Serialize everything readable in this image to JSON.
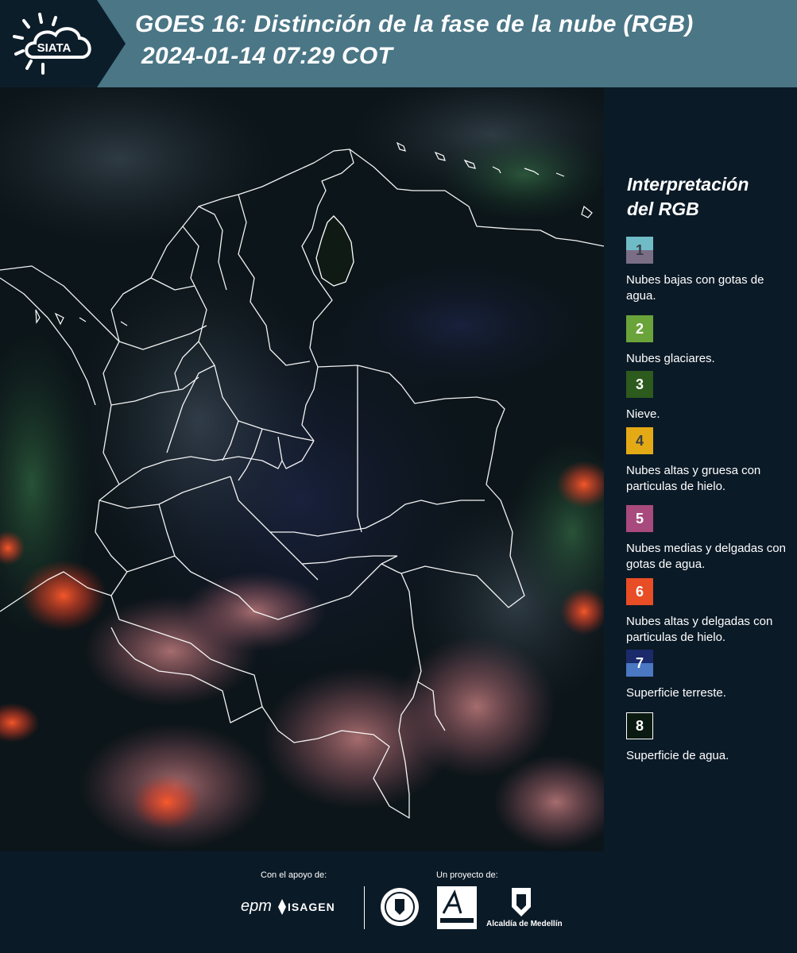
{
  "header": {
    "brand": "SIATA",
    "title_line1": "GOES 16: Distinción de la fase de la nube (RGB)",
    "title_line2": "2024-01-14 07:29 COT"
  },
  "colors": {
    "header_bg": "#4a7686",
    "header_dark": "#0c1d2a",
    "panel_bg": "#0b1a27",
    "border_line": "#ffffff"
  },
  "legend": {
    "title_line1": "Interpretación",
    "title_line2": "del RGB",
    "items": [
      {
        "num": "1",
        "color_top": "#6fbcc7",
        "color_bottom": "#7a6e86",
        "text": "Nubes bajas con gotas de agua."
      },
      {
        "num": "2",
        "color": "#6aa33a",
        "text": "Nubes glaciares."
      },
      {
        "num": "3",
        "color": "#2d5a1d",
        "text": "Nieve."
      },
      {
        "num": "4",
        "color": "#e4aa16",
        "text": "Nubes altas y gruesa con particulas de hielo."
      },
      {
        "num": "5",
        "color": "#a84a7d",
        "text": "Nubes medias y delgadas con gotas de agua."
      },
      {
        "num": "6",
        "color": "#e84d26",
        "text": "Nubes altas y delgadas con particulas de hielo."
      },
      {
        "num": "7",
        "color_top": "#1a2a6a",
        "color_bottom": "#4a78c2",
        "text": "Superficie terreste."
      },
      {
        "num": "8",
        "color": "#0a1a10",
        "text": "Superficie de agua."
      }
    ]
  },
  "footer": {
    "support_label": "Con el apoyo de:",
    "project_label": "Un proyecto de:",
    "epm": "epm",
    "isagen": "ISAGEN",
    "alcaldia": "Alcaldía de Medellín"
  }
}
